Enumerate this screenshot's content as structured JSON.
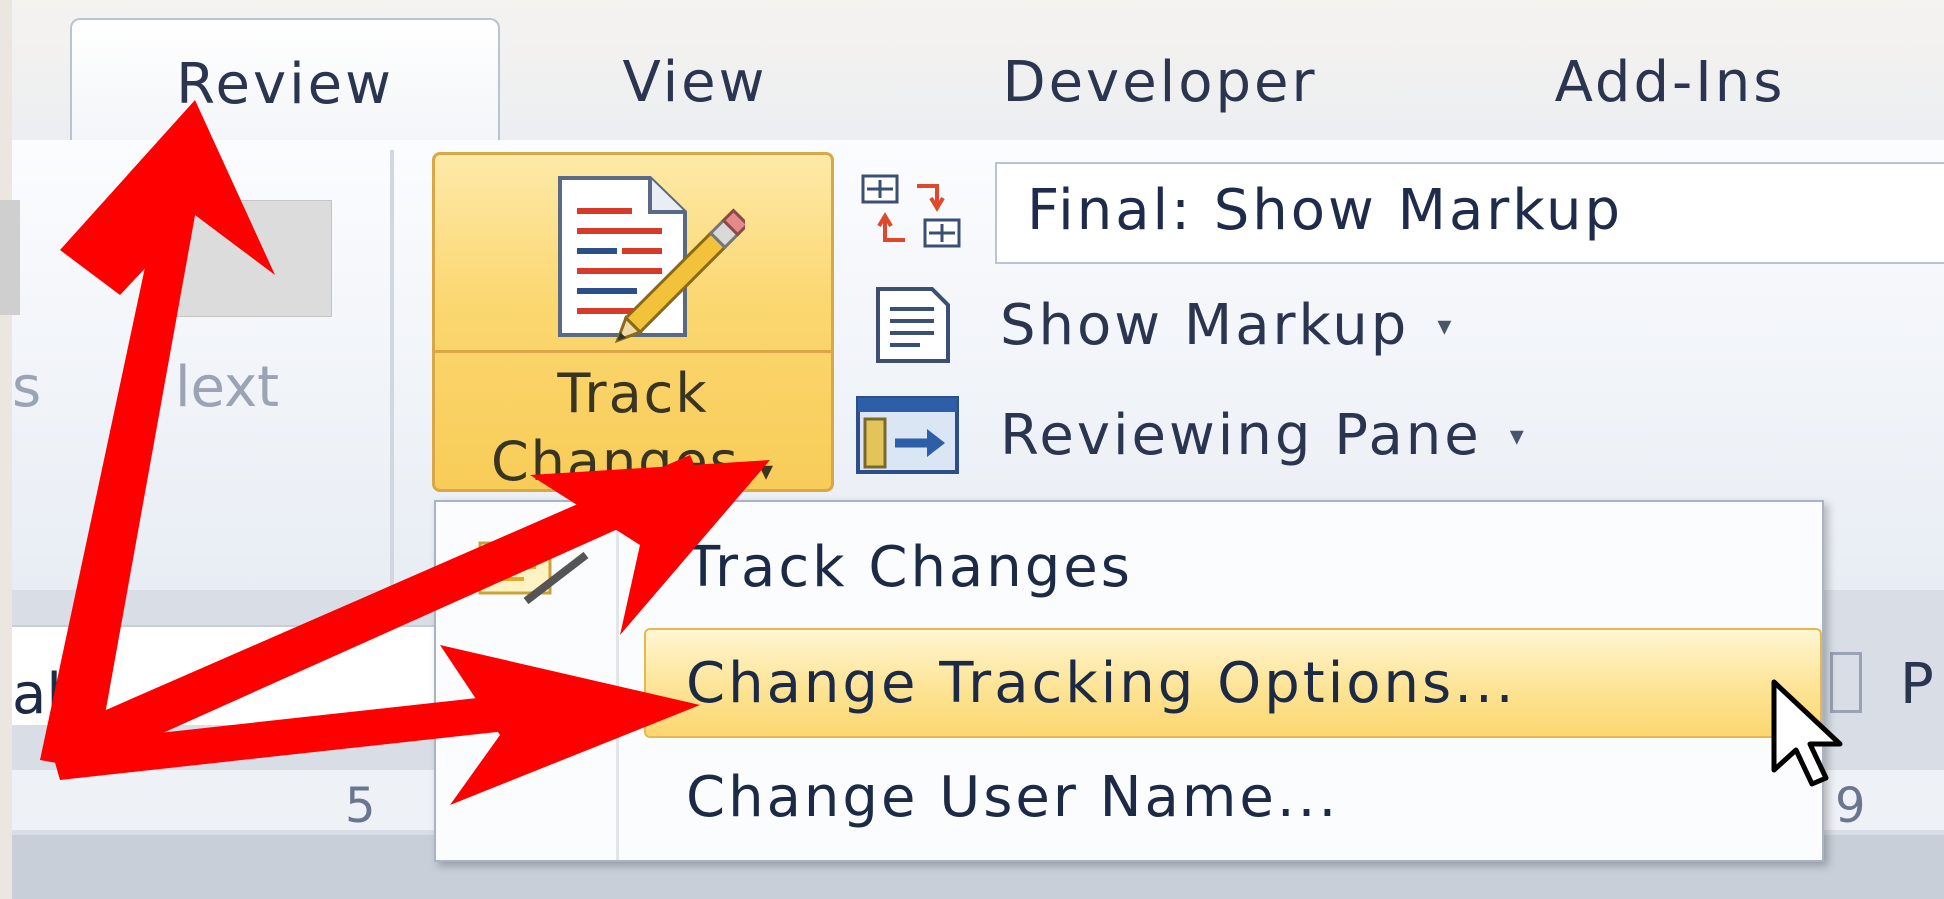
{
  "tabs": [
    {
      "label": "Review",
      "active": true
    },
    {
      "label": "View"
    },
    {
      "label": "Developer"
    },
    {
      "label": "Add-Ins"
    }
  ],
  "ribbon": {
    "ghost_prev_label": "s",
    "ghost_next_label": "lext",
    "track_changes": {
      "line1": "Track",
      "line2": "Changes",
      "caret": "▾"
    },
    "display_for_review": "Final: Show Markup",
    "show_markup": "Show Markup",
    "reviewing_pane": "Reviewing Pane",
    "caret": "▾"
  },
  "menu": {
    "items": [
      {
        "label": "Track Changes",
        "icon": "track-changes-small-icon"
      },
      {
        "label": "Change Tracking Options...",
        "highlighted": true
      },
      {
        "label": "Change User Name..."
      }
    ]
  },
  "lower": {
    "font_name_partial": "al",
    "ruler_left": "5",
    "ruler_right": "9",
    "paragraph_partial": "P"
  },
  "colors": {
    "highlight": "#fbd770",
    "arrow": "#ff0000",
    "text": "#1c2a45"
  }
}
